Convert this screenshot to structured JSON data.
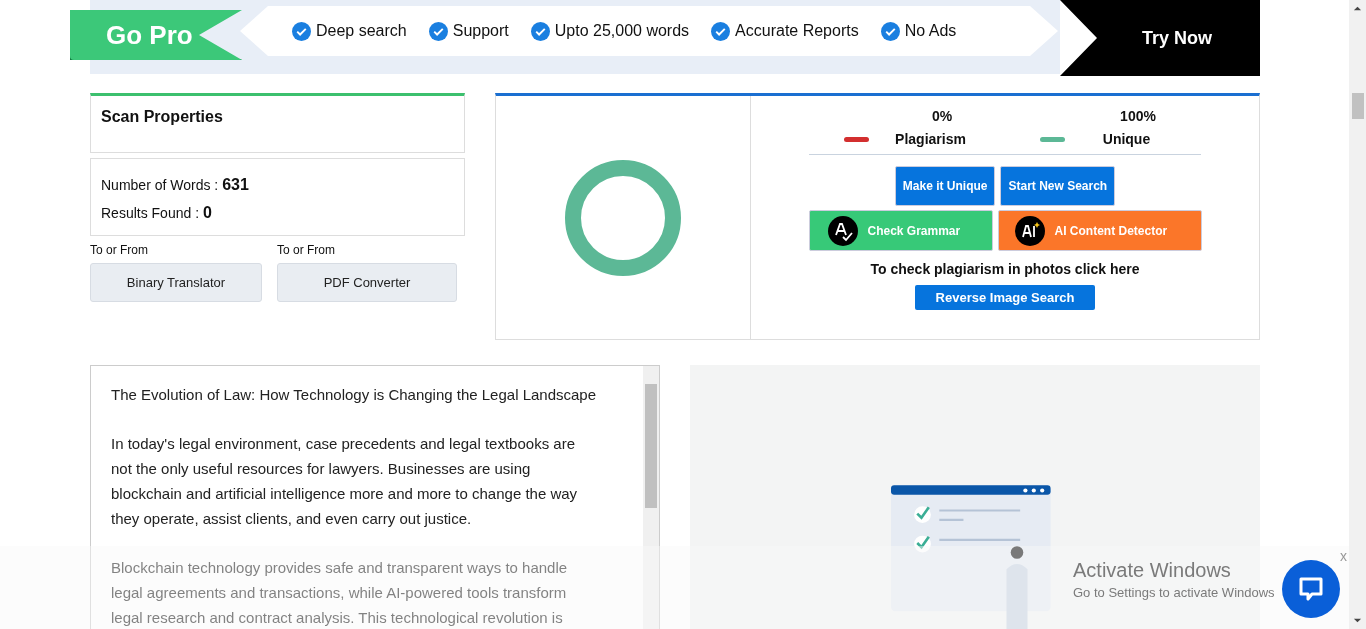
{
  "banner": {
    "badge": "Go Pro",
    "features": [
      "Deep search",
      "Support",
      "Upto 25,000 words",
      "Accurate Reports",
      "No Ads"
    ],
    "cta": "Try Now"
  },
  "scan_properties": {
    "title": "Scan Properties",
    "words_label": "Number of Words :",
    "words": "631",
    "results_label": "Results Found :",
    "results": "0"
  },
  "converters": [
    {
      "caption": "To or From",
      "button": "Binary Translator"
    },
    {
      "caption": "To or From",
      "button": "PDF Converter"
    }
  ],
  "results": {
    "legend": [
      {
        "percent": "0%",
        "label": "Plagiarism",
        "color": "#d32f2f"
      },
      {
        "percent": "100%",
        "label": "Unique",
        "color": "#5cb896"
      }
    ],
    "actions": [
      {
        "label": "Make it Unique",
        "kind": "blue"
      },
      {
        "label": "Start New Search",
        "kind": "blue"
      },
      {
        "label": "Check Grammar",
        "kind": "grammar"
      },
      {
        "label": "AI Content Detector",
        "kind": "ai"
      }
    ],
    "photo_hint": "To check plagiarism in photos click here",
    "reverse_button": "Reverse Image Search"
  },
  "editor": {
    "paragraphs": [
      "The Evolution of Law: How Technology is Changing the Legal Landscape",
      "In today's legal environment, case precedents and legal textbooks are not the only useful resources for lawyers. Businesses are using blockchain and artificial intelligence more and more to change the way they operate, assist clients, and even carry out justice.",
      "Blockchain technology provides safe and transparent ways to handle legal agreements and transactions, while AI-powered tools transform legal research and contract analysis. This technological revolution is"
    ]
  },
  "overlay": {
    "title": "Activate Windows",
    "subtitle": "Go to Settings to activate Windows",
    "close": "x"
  }
}
